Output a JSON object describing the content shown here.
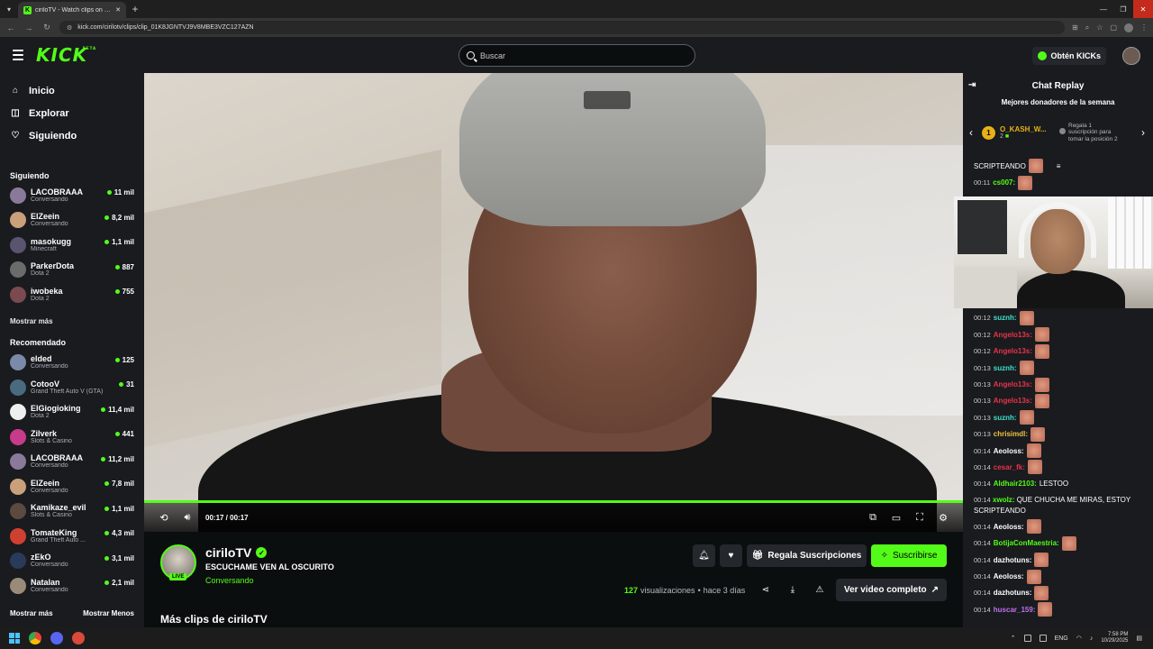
{
  "browser": {
    "tab_title": "ciriloTV - Watch clips on Ki...",
    "url": "kick.com/cirilotv/clips/clip_01K8JGNTVJ9V8MBE3VZC127AZN"
  },
  "header": {
    "logo": "KICK",
    "logo_badge": "BETA",
    "search_placeholder": "Buscar",
    "kicks_label": "Obtén KICKs"
  },
  "sidebar": {
    "nav": [
      {
        "label": "Inicio",
        "icon": "home-icon"
      },
      {
        "label": "Explorar",
        "icon": "compass-icon"
      },
      {
        "label": "Siguiendo",
        "icon": "heart-icon"
      }
    ],
    "following_title": "Siguiendo",
    "following": [
      {
        "name": "LACOBRAAA",
        "category": "Conversando",
        "viewers": "11 mil",
        "color": "#8a7a9a"
      },
      {
        "name": "ElZeein",
        "category": "Conversando",
        "viewers": "8,2 mil",
        "color": "#c9a07a"
      },
      {
        "name": "masokugg",
        "category": "Minecraft",
        "viewers": "1,1 mil",
        "color": "#5a5470"
      },
      {
        "name": "ParkerDota",
        "category": "Dota 2",
        "viewers": "887",
        "color": "#6b6b6b"
      },
      {
        "name": "iwobeka",
        "category": "Dota 2",
        "viewers": "755",
        "color": "#7a4a50"
      }
    ],
    "following_more": "Mostrar más",
    "recommended_title": "Recomendado",
    "recommended": [
      {
        "name": "elded",
        "category": "Conversando",
        "viewers": "125",
        "color": "#7a8aa8"
      },
      {
        "name": "CotooV",
        "category": "Grand Theft Auto V (GTA)",
        "viewers": "31",
        "color": "#4a6a80"
      },
      {
        "name": "ElGiogioking",
        "category": "Dota 2",
        "viewers": "11,4 mil",
        "color": "#eeeeee"
      },
      {
        "name": "Zilverk",
        "category": "Slots & Casino",
        "viewers": "441",
        "color": "#c83a8a"
      },
      {
        "name": "LACOBRAAA",
        "category": "Conversando",
        "viewers": "11,2 mil",
        "color": "#8a7a9a"
      },
      {
        "name": "ElZeein",
        "category": "Conversando",
        "viewers": "7,8 mil",
        "color": "#c9a07a"
      },
      {
        "name": "Kamikaze_evil",
        "category": "Slots & Casino",
        "viewers": "1,1 mil",
        "color": "#5a4a40"
      },
      {
        "name": "TomateKing",
        "category": "Grand Theft Auto ...",
        "viewers": "4,3 mil",
        "color": "#d04030"
      },
      {
        "name": "zEkO",
        "category": "Conversando",
        "viewers": "3,1 mil",
        "color": "#2a3a5a"
      },
      {
        "name": "Natalan",
        "category": "Conversando",
        "viewers": "2,1 mil",
        "color": "#9a8a7a"
      }
    ],
    "show_more": "Mostrar más",
    "show_less": "Mostrar Menos"
  },
  "player": {
    "time": "00:17 / 00:17",
    "progress": 1.0
  },
  "clip": {
    "streamer": "ciriloTV",
    "live_badge": "LIVE",
    "title": "ESCUCHAME VEN AL OSCURITO",
    "category": "Conversando",
    "gift_label": "Regala Suscripciones",
    "subscribe_label": "Suscribirse",
    "views_count": "127",
    "views_label": "visualizaciones",
    "separator": "•",
    "age": "hace 3 días",
    "full_video_label": "Ver video completo",
    "more_clips": "Más clips de ciriloTV"
  },
  "chat": {
    "title": "Chat Replay",
    "donors_title": "Mejores donadores de la semana",
    "top_donor": {
      "rank": "1",
      "name": "O_KASH_W...",
      "count": "2"
    },
    "donor_cta": "Regala 1 suscripción para tomar la posición 2",
    "first_line": "SCRIPTEANDO",
    "messages_top": [
      {
        "ts": "00:11",
        "user": "cs007:",
        "color": "#53fc18"
      }
    ],
    "messages": [
      {
        "ts": "00:12",
        "user": "suznh:",
        "color": "#3ee0c8",
        "text": ""
      },
      {
        "ts": "00:12",
        "user": "Angelo13s:",
        "color": "#e8334a",
        "text": ""
      },
      {
        "ts": "00:12",
        "user": "Angelo13s:",
        "color": "#e8334a",
        "text": ""
      },
      {
        "ts": "00:13",
        "user": "suznh:",
        "color": "#3ee0c8",
        "text": ""
      },
      {
        "ts": "00:13",
        "user": "Angelo13s:",
        "color": "#e8334a",
        "text": ""
      },
      {
        "ts": "00:13",
        "user": "Angelo13s:",
        "color": "#e8334a",
        "text": ""
      },
      {
        "ts": "00:13",
        "user": "suznh:",
        "color": "#3ee0c8",
        "text": ""
      },
      {
        "ts": "00:13",
        "user": "chrisimdl:",
        "color": "#f0c040",
        "text": ""
      },
      {
        "ts": "00:14",
        "user": "Aeoloss:",
        "color": "#ffffff",
        "text": ""
      },
      {
        "ts": "00:14",
        "user": "cesar_fk:",
        "color": "#e8334a",
        "text": ""
      },
      {
        "ts": "00:14",
        "user": "Aldhair2103:",
        "color": "#53fc18",
        "text": "LESTOO"
      }
    ],
    "wrap_message": {
      "ts": "00:14",
      "user": "xwolz:",
      "color": "#53fc18",
      "text": "QUE CHUCHA ME MIRAS, ESTOY SCRIPTEANDO"
    },
    "messages_bottom": [
      {
        "ts": "00:14",
        "user": "Aeoloss:",
        "color": "#ffffff"
      },
      {
        "ts": "00:14",
        "user": "BotijaConMaestria:",
        "color": "#53fc18"
      },
      {
        "ts": "00:14",
        "user": "dazhotuns:",
        "color": "#ffffff"
      },
      {
        "ts": "00:14",
        "user": "Aeoloss:",
        "color": "#ffffff"
      },
      {
        "ts": "00:14",
        "user": "dazhotuns:",
        "color": "#ffffff"
      },
      {
        "ts": "00:14",
        "user": "huscar_159:",
        "color": "#c070f0"
      }
    ]
  },
  "taskbar": {
    "lang": "ENG",
    "time": "7:58 PM",
    "date": "10/29/2025"
  },
  "colors": {
    "accent": "#53fc18",
    "bg": "#0b0e0f",
    "panel": "#191b1f"
  }
}
